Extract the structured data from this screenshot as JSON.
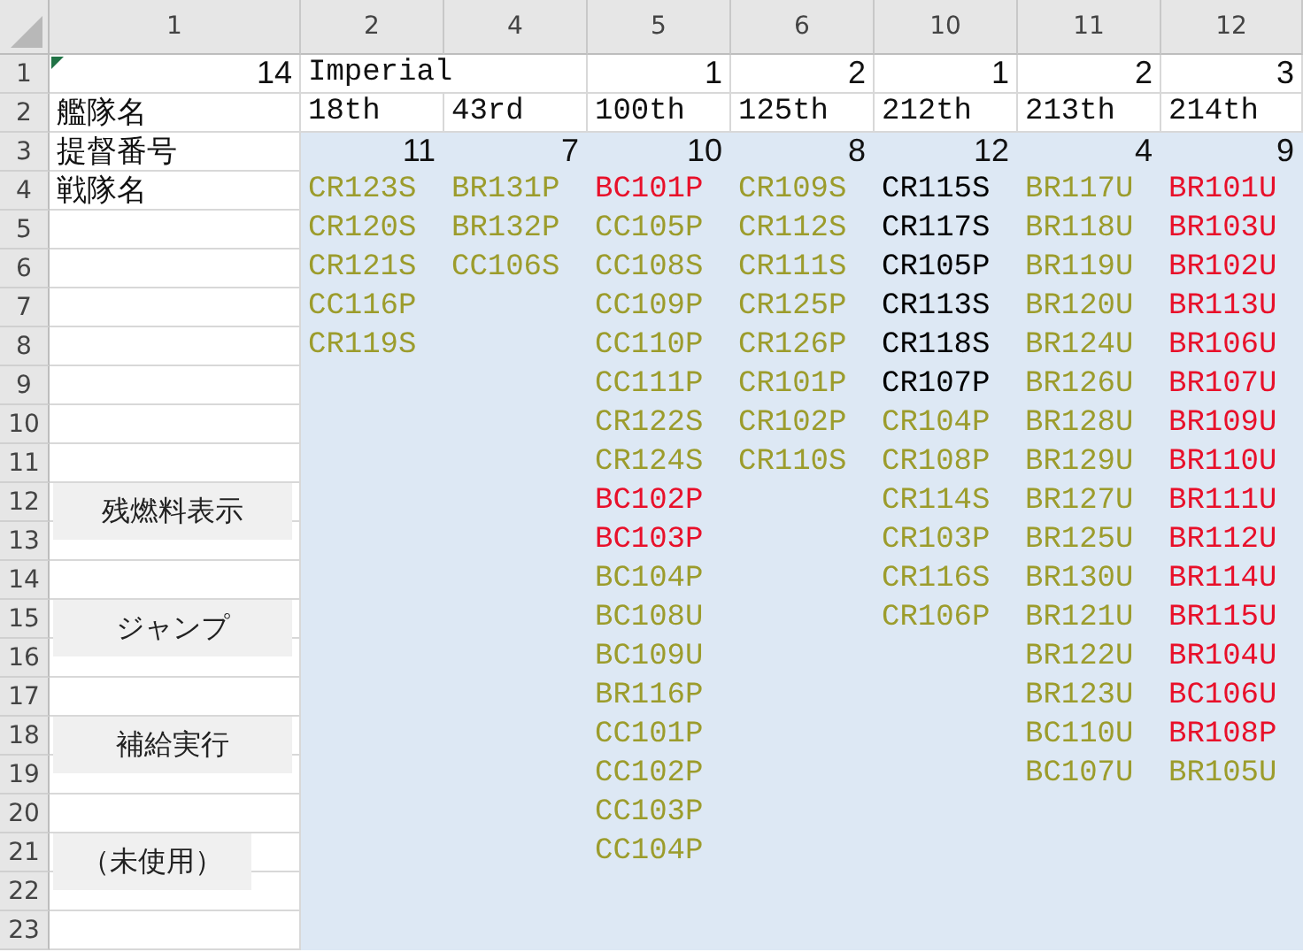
{
  "column_headers": [
    "1",
    "2",
    "4",
    "5",
    "6",
    "10",
    "11",
    "12"
  ],
  "row_headers": [
    "1",
    "2",
    "3",
    "4",
    "5",
    "6",
    "7",
    "8",
    "9",
    "10",
    "11",
    "12",
    "13",
    "14",
    "15",
    "16",
    "17",
    "18",
    "19",
    "20",
    "21",
    "22",
    "23"
  ],
  "top_cell": {
    "value": "14",
    "has_comment": true
  },
  "title": "Imperial",
  "labels": [
    "艦隊名",
    "提督番号",
    "戦隊名"
  ],
  "fleets": [
    {
      "name": "18th",
      "count": "11",
      "ships": [
        {
          "code": "CR123S",
          "color": "#9c9c2c"
        },
        {
          "code": "CR120S",
          "color": "#9c9c2c"
        },
        {
          "code": "CR121S",
          "color": "#9c9c2c"
        },
        {
          "code": "CC116P",
          "color": "#9c9c2c"
        },
        {
          "code": "CR119S",
          "color": "#9c9c2c"
        }
      ]
    },
    {
      "name": "43rd",
      "count": "7",
      "ships": [
        {
          "code": "BR131P",
          "color": "#9c9c2c"
        },
        {
          "code": "BR132P",
          "color": "#9c9c2c"
        },
        {
          "code": "CC106S",
          "color": "#9c9c2c"
        }
      ]
    },
    {
      "number": "1",
      "name": "100th",
      "count": "10",
      "ships": [
        {
          "code": "BC101P",
          "color": "#e8102a"
        },
        {
          "code": "CC105P",
          "color": "#9c9c2c"
        },
        {
          "code": "CC108S",
          "color": "#9c9c2c"
        },
        {
          "code": "CC109P",
          "color": "#9c9c2c"
        },
        {
          "code": "CC110P",
          "color": "#9c9c2c"
        },
        {
          "code": "CC111P",
          "color": "#9c9c2c"
        },
        {
          "code": "CR122S",
          "color": "#9c9c2c"
        },
        {
          "code": "CR124S",
          "color": "#9c9c2c"
        },
        {
          "code": "BC102P",
          "color": "#e8102a"
        },
        {
          "code": "BC103P",
          "color": "#e8102a"
        },
        {
          "code": "BC104P",
          "color": "#9c9c2c"
        },
        {
          "code": "BC108U",
          "color": "#9c9c2c"
        },
        {
          "code": "BC109U",
          "color": "#9c9c2c"
        },
        {
          "code": "BR116P",
          "color": "#9c9c2c"
        },
        {
          "code": "CC101P",
          "color": "#9c9c2c"
        },
        {
          "code": "CC102P",
          "color": "#9c9c2c"
        },
        {
          "code": "CC103P",
          "color": "#9c9c2c"
        },
        {
          "code": "CC104P",
          "color": "#9c9c2c"
        }
      ]
    },
    {
      "number": "2",
      "name": "125th",
      "count": "8",
      "ships": [
        {
          "code": "CR109S",
          "color": "#9c9c2c"
        },
        {
          "code": "CR112S",
          "color": "#9c9c2c"
        },
        {
          "code": "CR111S",
          "color": "#9c9c2c"
        },
        {
          "code": "CR125P",
          "color": "#9c9c2c"
        },
        {
          "code": "CR126P",
          "color": "#9c9c2c"
        },
        {
          "code": "CR101P",
          "color": "#9c9c2c"
        },
        {
          "code": "CR102P",
          "color": "#9c9c2c"
        },
        {
          "code": "CR110S",
          "color": "#9c9c2c"
        }
      ]
    },
    {
      "number": "1",
      "name": "212th",
      "count": "12",
      "ships": [
        {
          "code": "CR115S",
          "color": "#000000"
        },
        {
          "code": "CR117S",
          "color": "#000000"
        },
        {
          "code": "CR105P",
          "color": "#000000"
        },
        {
          "code": "CR113S",
          "color": "#000000"
        },
        {
          "code": "CR118S",
          "color": "#000000"
        },
        {
          "code": "CR107P",
          "color": "#000000"
        },
        {
          "code": "CR104P",
          "color": "#9c9c2c"
        },
        {
          "code": "CR108P",
          "color": "#9c9c2c"
        },
        {
          "code": "CR114S",
          "color": "#9c9c2c"
        },
        {
          "code": "CR103P",
          "color": "#9c9c2c"
        },
        {
          "code": "CR116S",
          "color": "#9c9c2c"
        },
        {
          "code": "CR106P",
          "color": "#9c9c2c"
        }
      ]
    },
    {
      "number": "2",
      "name": "213th",
      "count": "4",
      "ships": [
        {
          "code": "BR117U",
          "color": "#9c9c2c"
        },
        {
          "code": "BR118U",
          "color": "#9c9c2c"
        },
        {
          "code": "BR119U",
          "color": "#9c9c2c"
        },
        {
          "code": "BR120U",
          "color": "#9c9c2c"
        },
        {
          "code": "BR124U",
          "color": "#9c9c2c"
        },
        {
          "code": "BR126U",
          "color": "#9c9c2c"
        },
        {
          "code": "BR128U",
          "color": "#9c9c2c"
        },
        {
          "code": "BR129U",
          "color": "#9c9c2c"
        },
        {
          "code": "BR127U",
          "color": "#9c9c2c"
        },
        {
          "code": "BR125U",
          "color": "#9c9c2c"
        },
        {
          "code": "BR130U",
          "color": "#9c9c2c"
        },
        {
          "code": "BR121U",
          "color": "#9c9c2c"
        },
        {
          "code": "BR122U",
          "color": "#9c9c2c"
        },
        {
          "code": "BR123U",
          "color": "#9c9c2c"
        },
        {
          "code": "BC110U",
          "color": "#9c9c2c"
        },
        {
          "code": "BC107U",
          "color": "#9c9c2c"
        }
      ]
    },
    {
      "number": "3",
      "name": "214th",
      "count": "9",
      "ships": [
        {
          "code": "BR101U",
          "color": "#e8102a"
        },
        {
          "code": "BR103U",
          "color": "#e8102a"
        },
        {
          "code": "BR102U",
          "color": "#e8102a"
        },
        {
          "code": "BR113U",
          "color": "#e8102a"
        },
        {
          "code": "BR106U",
          "color": "#e8102a"
        },
        {
          "code": "BR107U",
          "color": "#e8102a"
        },
        {
          "code": "BR109U",
          "color": "#e8102a"
        },
        {
          "code": "BR110U",
          "color": "#e8102a"
        },
        {
          "code": "BR111U",
          "color": "#e8102a"
        },
        {
          "code": "BR112U",
          "color": "#e8102a"
        },
        {
          "code": "BR114U",
          "color": "#e8102a"
        },
        {
          "code": "BR115U",
          "color": "#e8102a"
        },
        {
          "code": "BR104U",
          "color": "#e8102a"
        },
        {
          "code": "BC106U",
          "color": "#e8102a"
        },
        {
          "code": "BR108P",
          "color": "#e8102a"
        },
        {
          "code": "BR105U",
          "color": "#9c9c2c"
        }
      ]
    }
  ],
  "buttons": [
    "残燃料表示",
    "ジャンプ",
    "補給実行",
    "（未使用）"
  ]
}
